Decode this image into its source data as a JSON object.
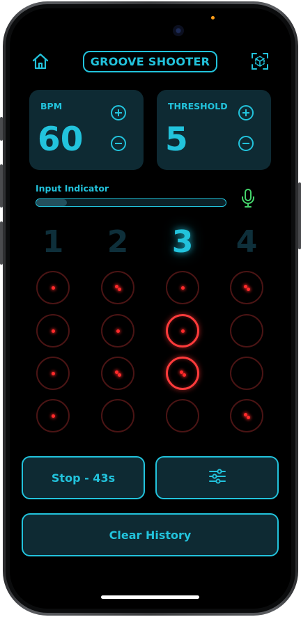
{
  "header": {
    "title": "GROOVE SHOOTER",
    "home_icon": "home-icon",
    "focus_icon": "focus-frame-icon"
  },
  "bpm": {
    "label": "BPM",
    "value": "60"
  },
  "threshold": {
    "label": "THRESHOLD",
    "value": "5"
  },
  "input": {
    "label": "Input Indicator",
    "level": 0.16,
    "mic_icon": "microphone-icon"
  },
  "beats": [
    "1",
    "2",
    "3",
    "4"
  ],
  "active_beat": 3,
  "grid": [
    [
      {
        "hits": 1,
        "bright": false
      },
      {
        "hits": 2,
        "bright": false
      },
      {
        "hits": 1,
        "bright": false
      },
      {
        "hits": 2,
        "bright": false
      }
    ],
    [
      {
        "hits": 1,
        "bright": false
      },
      {
        "hits": 1,
        "bright": false
      },
      {
        "hits": 1,
        "bright": true
      },
      {
        "hits": 0,
        "bright": false
      }
    ],
    [
      {
        "hits": 1,
        "bright": false
      },
      {
        "hits": 2,
        "bright": false
      },
      {
        "hits": 2,
        "bright": true
      },
      {
        "hits": 0,
        "bright": false
      }
    ],
    [
      {
        "hits": 1,
        "bright": false
      },
      {
        "hits": 0,
        "bright": false
      },
      {
        "hits": 0,
        "bright": false
      },
      {
        "hits": 2,
        "bright": false
      }
    ]
  ],
  "controls": {
    "stop_label": "Stop - 43s",
    "settings_icon": "sliders-icon",
    "clear_label": "Clear History"
  },
  "colors": {
    "accent": "#22c3dc",
    "card": "#0e2a33",
    "hit": "#ff2b2b",
    "mic": "#44d36b"
  }
}
